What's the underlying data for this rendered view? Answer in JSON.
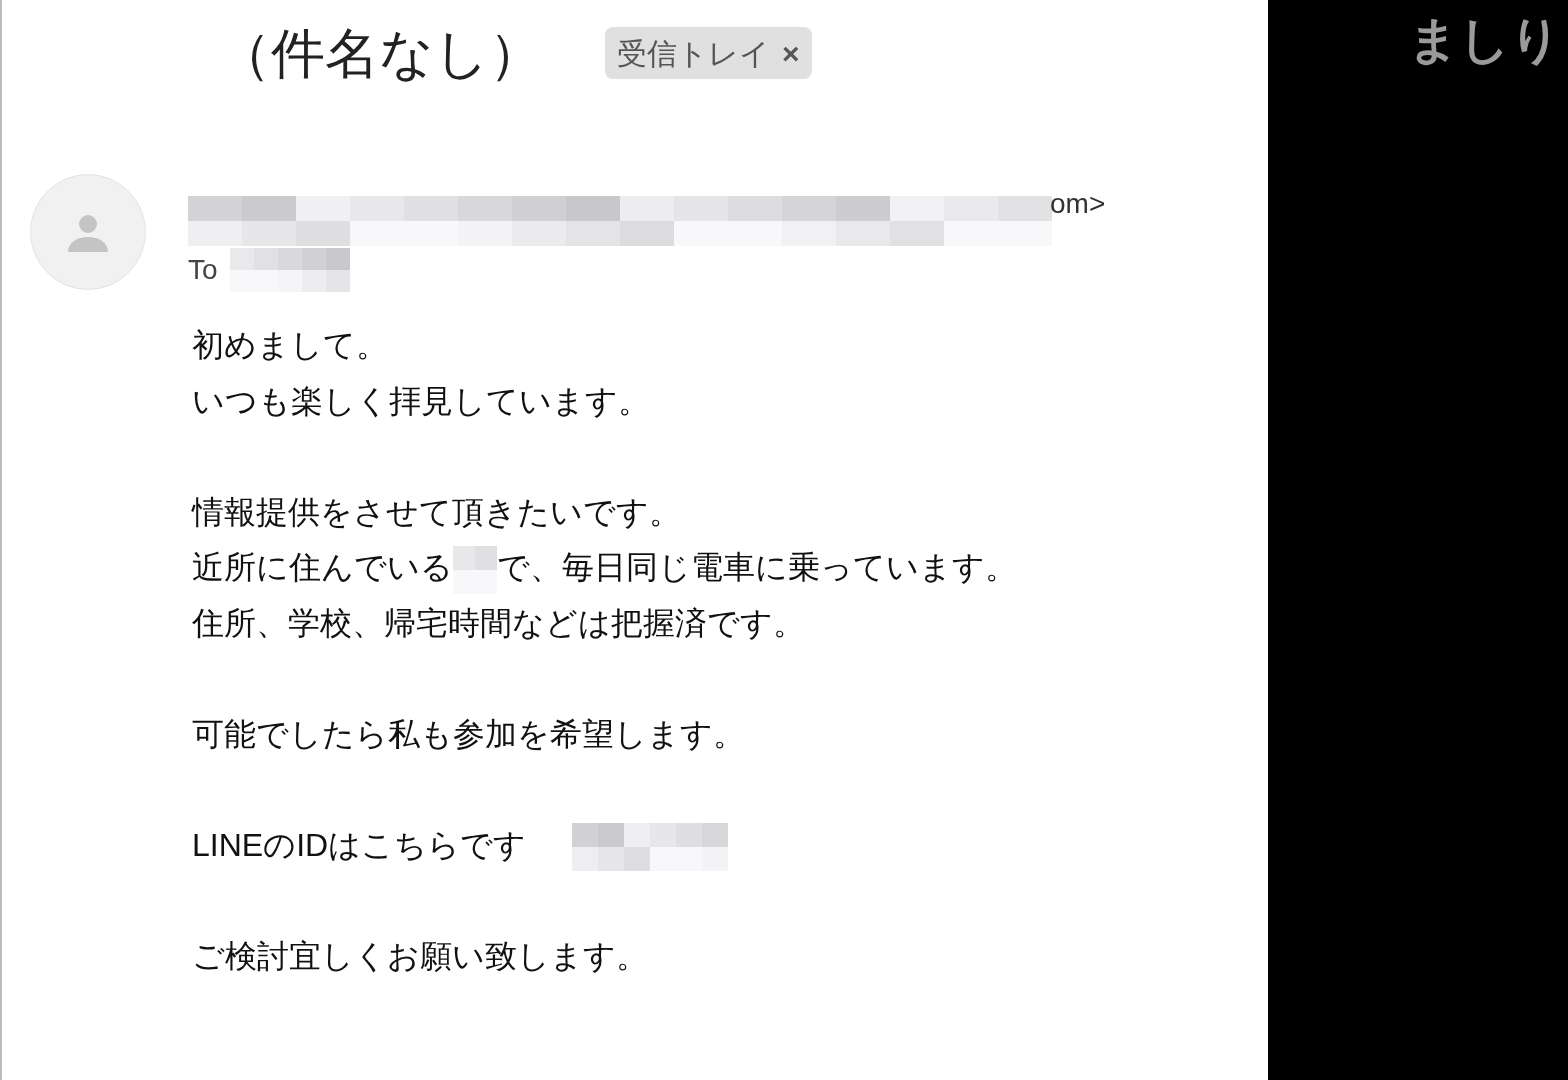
{
  "email": {
    "subject": "（件名なし）",
    "label": {
      "text": "受信トレイ",
      "remove": "×"
    },
    "sender": {
      "tail": "om>"
    },
    "to": {
      "label": "To"
    },
    "body": [
      {
        "lines": [
          [
            {
              "kind": "text",
              "text": "初めまして。"
            }
          ],
          [
            {
              "kind": "text",
              "text": "いつも楽しく拝見しています。"
            }
          ]
        ]
      },
      {
        "lines": [
          [
            {
              "kind": "text",
              "text": "情報提供をさせて頂きたいです。"
            }
          ],
          [
            {
              "kind": "text",
              "text": "近所に住んでいる"
            },
            {
              "kind": "redacted"
            },
            {
              "kind": "text",
              "text": "で、毎日同じ電車に乗っています。"
            }
          ],
          [
            {
              "kind": "text",
              "text": "住所、学校、帰宅時間などは把握済です。"
            }
          ]
        ]
      },
      {
        "lines": [
          [
            {
              "kind": "text",
              "text": "可能でしたら私も参加を希望します。"
            }
          ]
        ]
      },
      {
        "lines": [
          [
            {
              "kind": "text",
              "text": "LINEのIDはこちらです"
            },
            {
              "kind": "redacted"
            }
          ]
        ]
      },
      {
        "lines": [
          [
            {
              "kind": "text",
              "text": "ご検討宜しくお願い致します。"
            }
          ]
        ]
      }
    ]
  },
  "side_panel": {
    "text": "ましり"
  }
}
